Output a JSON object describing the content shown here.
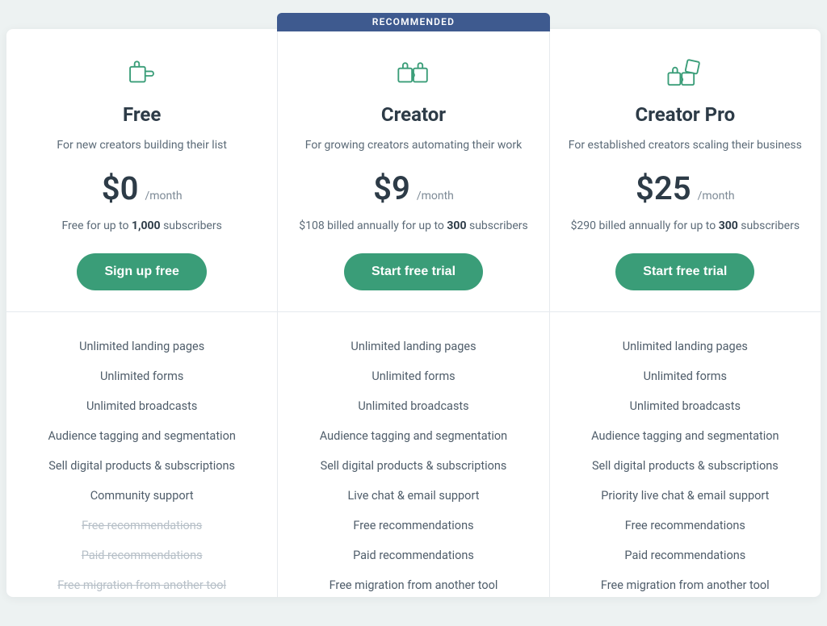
{
  "recommended_label": "RECOMMENDED",
  "plans": [
    {
      "id": "free",
      "name": "Free",
      "tagline": "For new creators building their list",
      "price": "$0",
      "period": "/month",
      "billing_prefix": "Free for up to ",
      "billing_bold": "1,000",
      "billing_suffix": " subscribers",
      "cta": "Sign up free",
      "recommended": false,
      "features": [
        {
          "text": "Unlimited landing pages",
          "included": true
        },
        {
          "text": "Unlimited forms",
          "included": true
        },
        {
          "text": "Unlimited broadcasts",
          "included": true
        },
        {
          "text": "Audience tagging and segmentation",
          "included": true
        },
        {
          "text": "Sell digital products & subscriptions",
          "included": true
        },
        {
          "text": "Community support",
          "included": true
        },
        {
          "text": "Free recommendations",
          "included": false
        },
        {
          "text": "Paid recommendations",
          "included": false
        },
        {
          "text": "Free migration from another tool",
          "included": false
        }
      ]
    },
    {
      "id": "creator",
      "name": "Creator",
      "tagline": "For growing creators automating their work",
      "price": "$9",
      "period": "/month",
      "billing_prefix": "$108 billed annually for up to ",
      "billing_bold": "300",
      "billing_suffix": " subscribers",
      "cta": "Start free trial",
      "recommended": true,
      "features": [
        {
          "text": "Unlimited landing pages",
          "included": true
        },
        {
          "text": "Unlimited forms",
          "included": true
        },
        {
          "text": "Unlimited broadcasts",
          "included": true
        },
        {
          "text": "Audience tagging and segmentation",
          "included": true
        },
        {
          "text": "Sell digital products & subscriptions",
          "included": true
        },
        {
          "text": "Live chat & email support",
          "included": true
        },
        {
          "text": "Free recommendations",
          "included": true
        },
        {
          "text": "Paid recommendations",
          "included": true
        },
        {
          "text": "Free migration from another tool",
          "included": true
        }
      ]
    },
    {
      "id": "creator-pro",
      "name": "Creator Pro",
      "tagline": "For established creators scaling their business",
      "price": "$25",
      "period": "/month",
      "billing_prefix": "$290 billed annually for up to ",
      "billing_bold": "300",
      "billing_suffix": " subscribers",
      "cta": "Start free trial",
      "recommended": false,
      "features": [
        {
          "text": "Unlimited landing pages",
          "included": true
        },
        {
          "text": "Unlimited forms",
          "included": true
        },
        {
          "text": "Unlimited broadcasts",
          "included": true
        },
        {
          "text": "Audience tagging and segmentation",
          "included": true
        },
        {
          "text": "Sell digital products & subscriptions",
          "included": true
        },
        {
          "text": "Priority live chat & email support",
          "included": true
        },
        {
          "text": "Free recommendations",
          "included": true
        },
        {
          "text": "Paid recommendations",
          "included": true
        },
        {
          "text": "Free migration from another tool",
          "included": true
        }
      ]
    }
  ]
}
